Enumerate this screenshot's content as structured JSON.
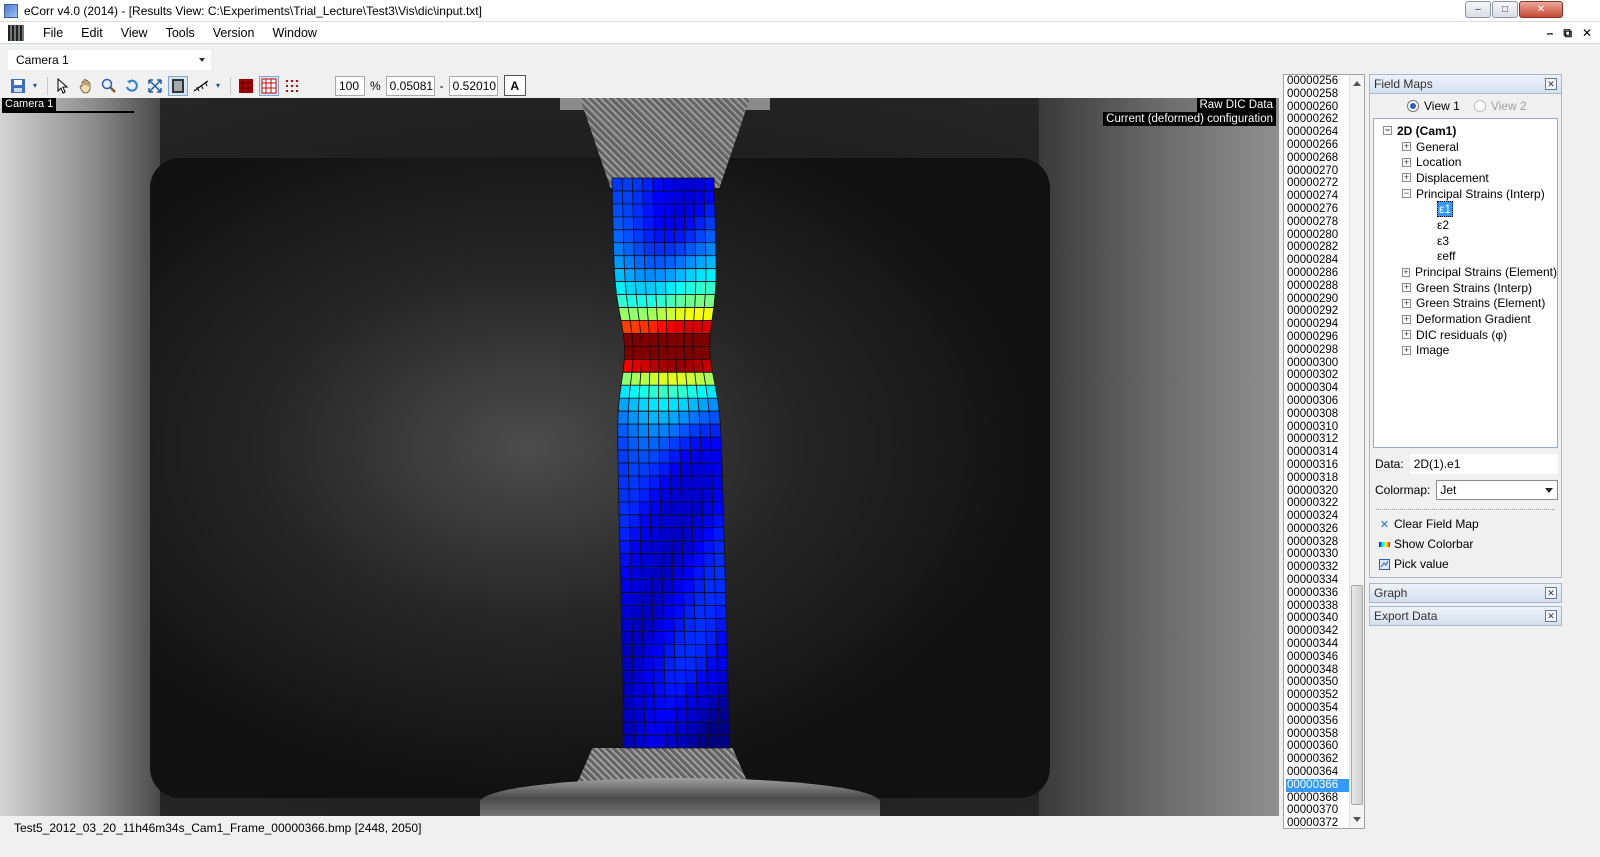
{
  "window": {
    "title": "eCorr v4.0 (2014) - [Results View: C:\\Experiments\\Trial_Lecture\\Test3\\Vis\\dic\\input.txt]",
    "minimize": "–",
    "maximize": "□",
    "close": "✕"
  },
  "menubar": {
    "items": [
      "File",
      "Edit",
      "View",
      "Tools",
      "Version",
      "Window"
    ],
    "mdi_controls": [
      "–",
      "⧉",
      "✕"
    ]
  },
  "camera_bar": {
    "selected": "Camera 1"
  },
  "toolbar": {
    "zoom_value": "100",
    "zoom_unit": "%",
    "range_min": "0.05081",
    "range_sep": "-",
    "range_max": "0.52010",
    "text_toggle": "A"
  },
  "viewport": {
    "camera_tag": "Camera 1",
    "data_source": "Raw DIC Data",
    "configuration": "Current (deformed) configuration",
    "strain_field": {
      "colormap": "Jet",
      "value_min": 0.05081,
      "value_max": 0.5201,
      "grid_cols": 10,
      "grid_rows": 44,
      "peak_row_fraction": 0.3
    }
  },
  "statusbar": {
    "text": "Test5_2012_03_20_11h46m34s_Cam1_Frame_00000366.bmp [2448, 2050]"
  },
  "frame_list": {
    "items": [
      "00000256",
      "00000258",
      "00000260",
      "00000262",
      "00000264",
      "00000266",
      "00000268",
      "00000270",
      "00000272",
      "00000274",
      "00000276",
      "00000278",
      "00000280",
      "00000282",
      "00000284",
      "00000286",
      "00000288",
      "00000290",
      "00000292",
      "00000294",
      "00000296",
      "00000298",
      "00000300",
      "00000302",
      "00000304",
      "00000306",
      "00000308",
      "00000310",
      "00000312",
      "00000314",
      "00000316",
      "00000318",
      "00000320",
      "00000322",
      "00000324",
      "00000326",
      "00000328",
      "00000330",
      "00000332",
      "00000334",
      "00000336",
      "00000338",
      "00000340",
      "00000342",
      "00000344",
      "00000346",
      "00000348",
      "00000350",
      "00000352",
      "00000354",
      "00000356",
      "00000358",
      "00000360",
      "00000362",
      "00000364",
      "00000366",
      "00000368",
      "00000370",
      "00000372"
    ],
    "selected": "00000366"
  },
  "field_maps": {
    "title": "Field Maps",
    "close": "✕",
    "view1": "View 1",
    "view2": "View 2",
    "tree": {
      "root": "2D (Cam1)",
      "general": "General",
      "location": "Location",
      "displacement": "Displacement",
      "principal_interp": "Principal Strains (Interp)",
      "e1": "ε1",
      "e2": "ε2",
      "e3": "ε3",
      "eeff": "εeff",
      "principal_element": "Principal Strains (Element)",
      "green_interp": "Green Strains (Interp)",
      "green_element": "Green Strains (Element)",
      "deformation_gradient": "Deformation Gradient",
      "dic_residuals": "DIC residuals (φ)",
      "image": "Image"
    },
    "data_label": "Data:",
    "data_value": "2D(1).e1",
    "colormap_label": "Colormap:",
    "colormap_value": "Jet",
    "actions": {
      "clear": "Clear Field Map",
      "colorbar": "Show Colorbar",
      "pick": "Pick value"
    }
  },
  "graph_panel": {
    "title": "Graph",
    "close": "✕"
  },
  "export_panel": {
    "title": "Export Data",
    "close": "✕"
  },
  "colors": {
    "selection": "#3399ff",
    "panel_header": "#d5dfee"
  }
}
